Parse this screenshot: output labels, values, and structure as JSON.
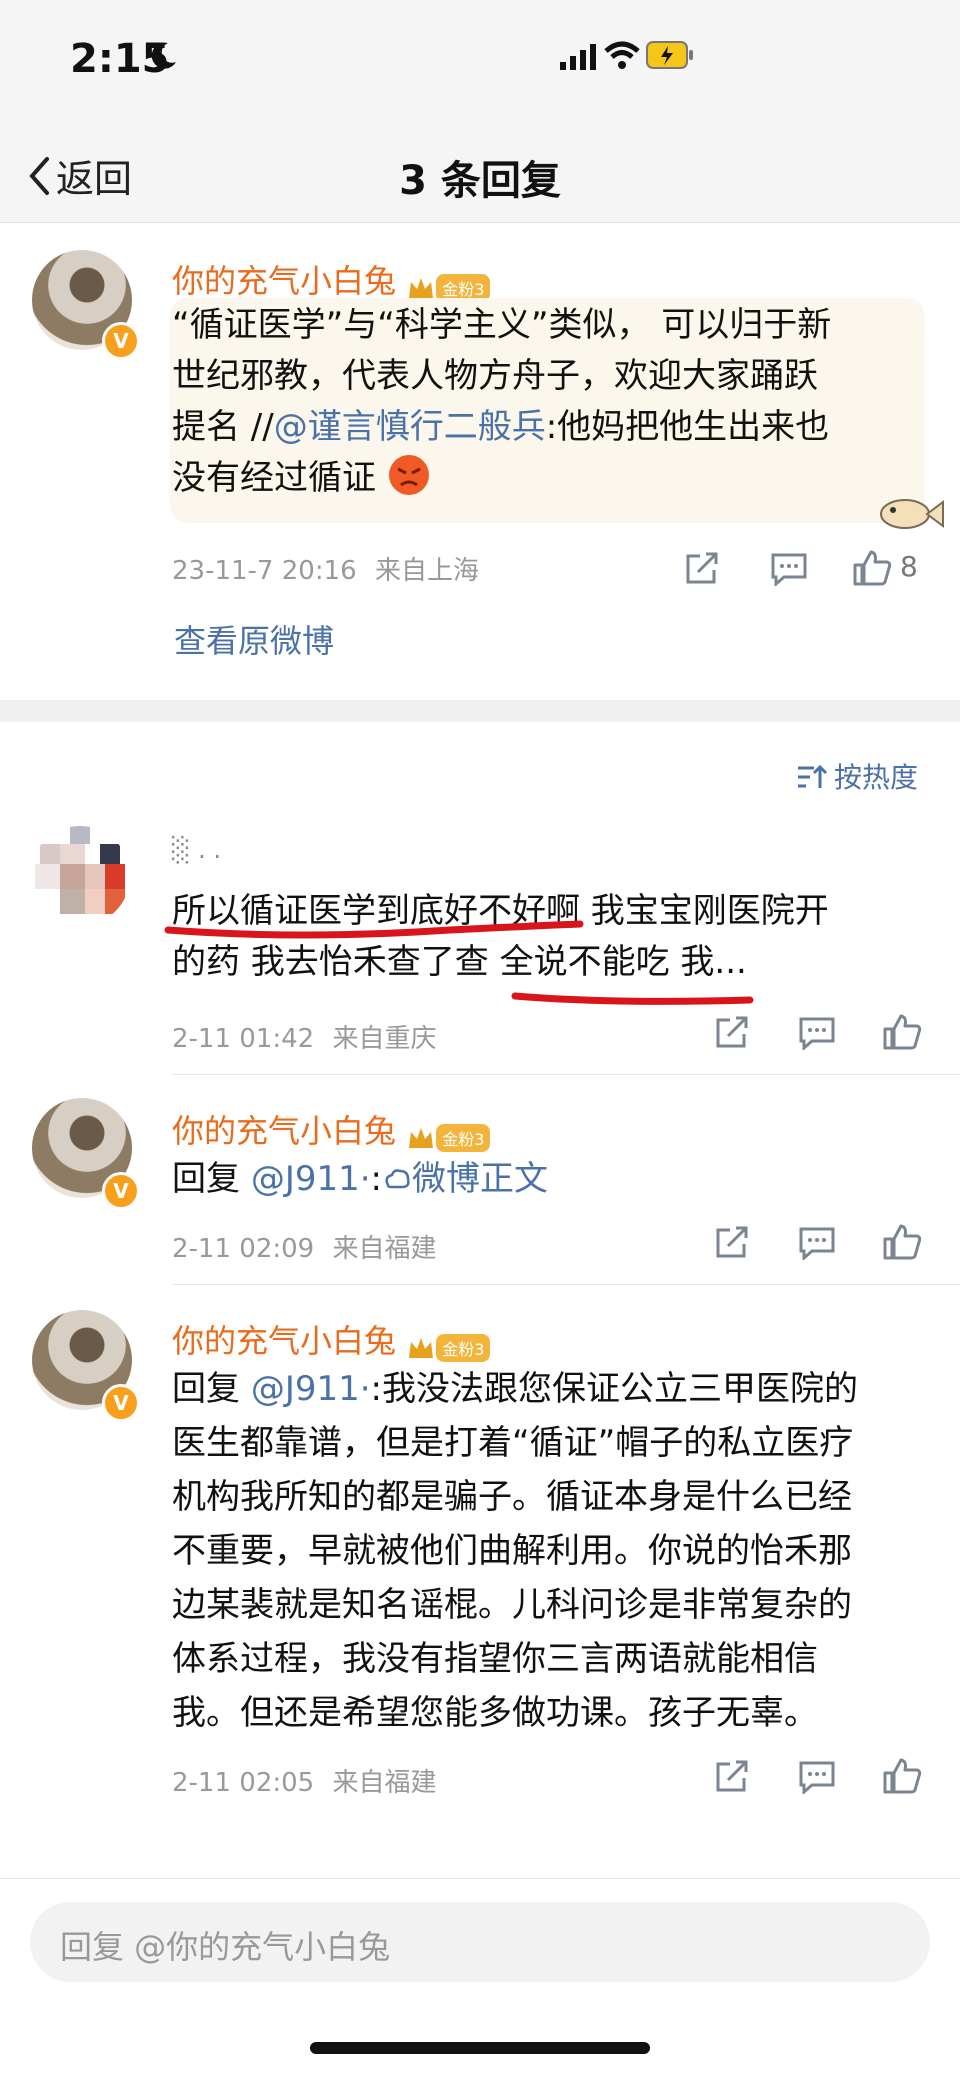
{
  "status": {
    "time": "2:15"
  },
  "nav": {
    "back_label": "返回",
    "title": "3 条回复"
  },
  "main_post": {
    "username": "你的充气小白兔",
    "fan_badge": "金粉3",
    "text_part1": "“循证医学”与“科学主义”类似， 可以归于新",
    "text_part2": "世纪邪教，代表人物方舟子，欢迎大家踊跃",
    "text_part3_a": "提名 //",
    "text_part3_mention": "@谨言慎行二般兵",
    "text_part3_b": ":他妈把他生出来也",
    "text_part4": "没有经过循证",
    "timestamp": "23-11-7 20:16",
    "location": "来自上海",
    "like_count": "8",
    "view_original": "查看原微博"
  },
  "sort_label": "按热度",
  "replies": [
    {
      "username": "░ . .",
      "line1": "所以循证医学到底好不好啊  我宝宝刚医院开",
      "line2": "的药  我去怡禾查了查  全说不能吃  我...",
      "timestamp": "2-11 01:42",
      "location": "来自重庆"
    },
    {
      "username": "你的充气小白兔",
      "fan_badge": "金粉3",
      "prefix": "回复 ",
      "mention": "@J911·",
      "colon": ":",
      "weibo_link": "微博正文",
      "timestamp": "2-11 02:09",
      "location": "来自福建"
    },
    {
      "username": "你的充气小白兔",
      "fan_badge": "金粉3",
      "prefix": "回复 ",
      "mention": "@J911·",
      "line1_rest": ":我没法跟您保证公立三甲医院的",
      "line2": "医生都靠谱，但是打着“循证”帽子的私立医疗",
      "line3": "机构我所知的都是骗子。循证本身是什么已经",
      "line4": "不重要，早就被他们曲解利用。你说的怡禾那",
      "line5": "边某裴就是知名谣棍。儿科问诊是非常复杂的",
      "line6": "体系过程，我没有指望你三言两语就能相信",
      "line7": "我。但还是希望您能多做功课。孩子无辜。",
      "timestamp": "2-11 02:05",
      "location": "来自福建"
    }
  ],
  "input": {
    "placeholder": "回复 @你的充气小白兔"
  },
  "colors": {
    "accent_link": "#4a72a8",
    "username": "#ea6b1b",
    "annotation": "#d8151a"
  }
}
